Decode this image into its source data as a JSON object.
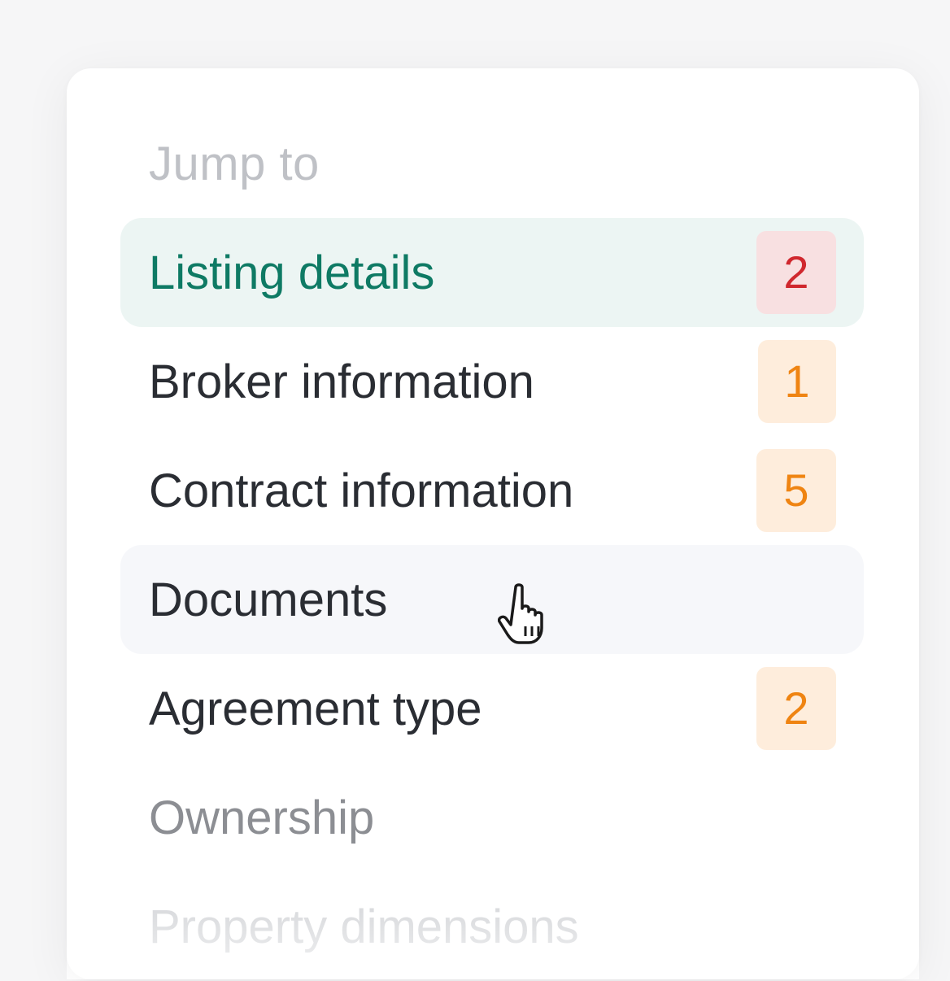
{
  "panel": {
    "heading": "Jump to",
    "items": [
      {
        "label": "Listing details",
        "count": "2",
        "state": "active",
        "badge_type": "error"
      },
      {
        "label": "Broker information",
        "count": "1",
        "state": "default",
        "badge_type": "warning"
      },
      {
        "label": "Contract information",
        "count": "5",
        "state": "default",
        "badge_type": "warning"
      },
      {
        "label": "Documents",
        "count": "",
        "state": "hover",
        "badge_type": "none"
      },
      {
        "label": "Agreement type",
        "count": "2",
        "state": "default",
        "badge_type": "warning"
      },
      {
        "label": "Ownership",
        "count": "",
        "state": "muted",
        "badge_type": "none"
      },
      {
        "label": "Property dimensions",
        "count": "",
        "state": "faded",
        "badge_type": "none"
      }
    ]
  },
  "colors": {
    "active_text": "#0e7a64",
    "active_bg": "#ecf5f3",
    "error_badge_text": "#d0282e",
    "error_badge_bg": "#f8e0e1",
    "warning_badge_text": "#ef8412",
    "warning_badge_bg": "#feeddc"
  },
  "cursor_icon": "hand-pointer-icon"
}
